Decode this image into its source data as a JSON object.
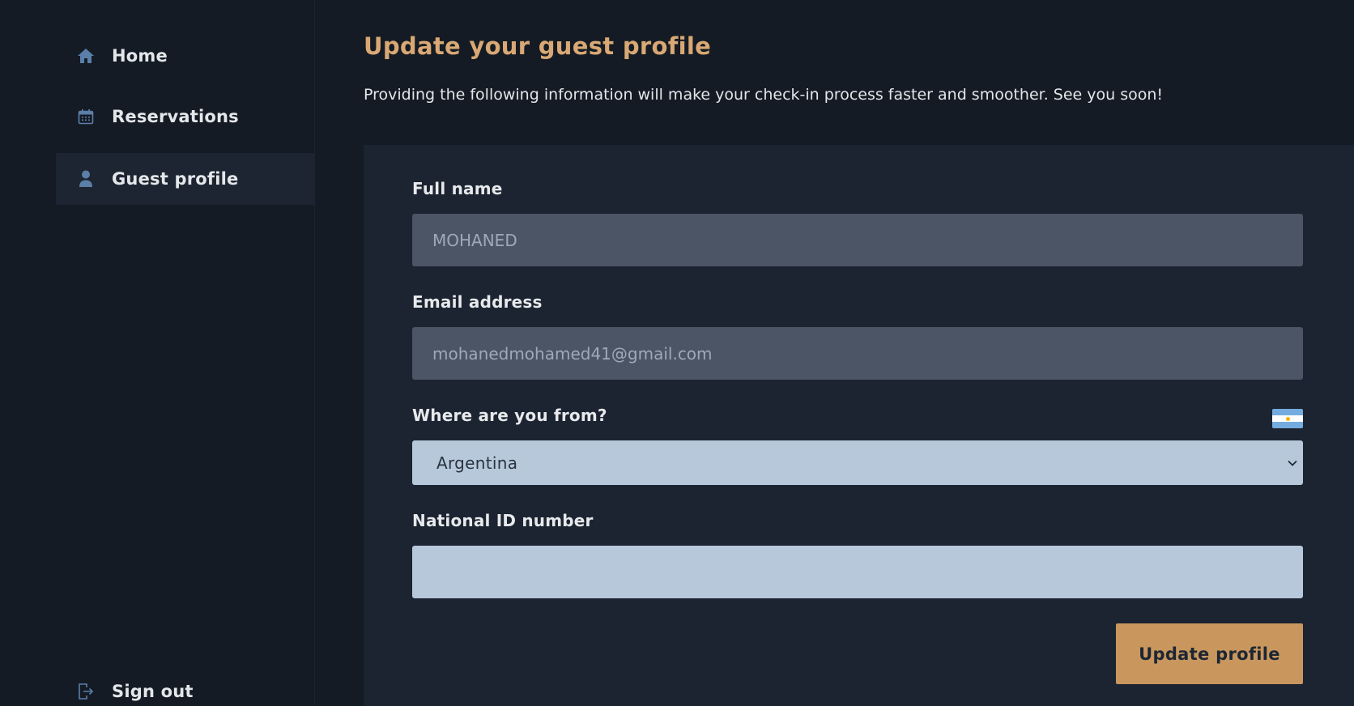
{
  "sidebar": {
    "items": [
      {
        "label": "Home",
        "icon": "home-icon"
      },
      {
        "label": "Reservations",
        "icon": "calendar-icon"
      },
      {
        "label": "Guest profile",
        "icon": "user-icon",
        "active": true
      }
    ],
    "sign_out": {
      "label": "Sign out",
      "icon": "sign-out-icon"
    }
  },
  "main": {
    "title": "Update your guest profile",
    "subtitle": "Providing the following information will make your check-in process faster and smoother. See you soon!"
  },
  "form": {
    "full_name": {
      "label": "Full name",
      "value": "MOHANED"
    },
    "email": {
      "label": "Email address",
      "value": "mohanedmohamed41@gmail.com"
    },
    "country": {
      "label": "Where are you from?",
      "value": "Argentina",
      "flag": "argentina-flag"
    },
    "national_id": {
      "label": "National ID number",
      "value": ""
    },
    "submit_label": "Update profile"
  },
  "colors": {
    "background": "#141b24",
    "card": "#1b2430",
    "accent": "#d9a874",
    "button": "#c9975e",
    "input_disabled": "#4b5566",
    "input_light": "#b7c8da",
    "icon": "#5b7fa8"
  }
}
